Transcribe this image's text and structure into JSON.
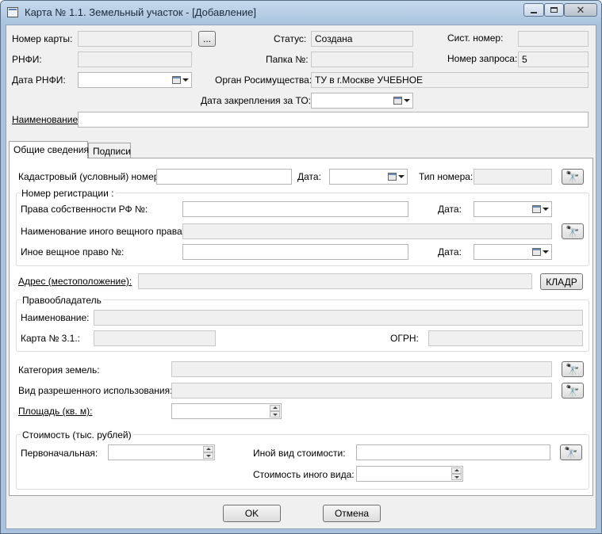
{
  "window": {
    "title": "Карта № 1.1. Земельный участок - [Добавление]"
  },
  "header": {
    "card_number_label": "Номер карты:",
    "card_number_value": "",
    "browse_label": "...",
    "rnfi_label": "РНФИ:",
    "rnfi_value": "",
    "rnfi_date_label": "Дата РНФИ:",
    "status_label": "Статус:",
    "status_value": "Создана",
    "folder_label": "Папка №:",
    "folder_value": "",
    "organ_label": "Орган Росимущества:",
    "organ_value": "ТУ в г.Москве УЧЕБНОЕ",
    "assign_date_label": "Дата закрепления за ТО:",
    "sys_number_label": "Сист. номер:",
    "sys_number_value": "",
    "request_number_label": "Номер запроса:",
    "request_number_value": "5",
    "name_label": "Наименование:",
    "name_value": ""
  },
  "tabs": [
    {
      "label": "Общие сведения",
      "active": true
    },
    {
      "label": "Подписи",
      "active": false
    }
  ],
  "general": {
    "cadastral_label": "Кадастровый (условный) номер:",
    "cadastral_value": "",
    "cadastral_date_label": "Дата:",
    "number_type_label": "Тип номера:",
    "number_type_value": "",
    "registration_group": "Номер регистрации :",
    "fed_property_label": "Права собственности РФ №:",
    "fed_property_value": "",
    "fed_property_date_label": "Дата:",
    "other_right_name_label": "Наименование иного вещного права:",
    "other_right_name_value": "",
    "other_right_label": "Иное вещное право №:",
    "other_right_value": "",
    "other_right_date_label": "Дата:",
    "address_label": "Адрес (местоположение):",
    "address_value": "",
    "kladr_label": "КЛАДР",
    "holder_group": "Правообладатель",
    "holder_name_label": "Наименование:",
    "holder_name_value": "",
    "card31_label": "Карта № 3.1.:",
    "card31_value": "",
    "ogrn_label": "ОГРН:",
    "ogrn_value": "",
    "land_category_label": "Категория земель:",
    "land_category_value": "",
    "permitted_use_label": "Вид разрешенного использования:",
    "permitted_use_value": "",
    "area_label": "Площадь (кв. м):",
    "area_value": "",
    "cost_group": "Стоимость (тыс. рублей)",
    "initial_cost_label": "Первоначальная:",
    "initial_cost_value": "",
    "other_cost_type_label": "Иной вид стоимости:",
    "other_cost_type_value": "",
    "other_cost_label": "Стоимость иного вида:",
    "other_cost_value": ""
  },
  "footer": {
    "ok_label": "OK",
    "cancel_label": "Отмена"
  },
  "icons": {
    "search": "binoculars-icon",
    "calendar": "calendar-icon"
  }
}
